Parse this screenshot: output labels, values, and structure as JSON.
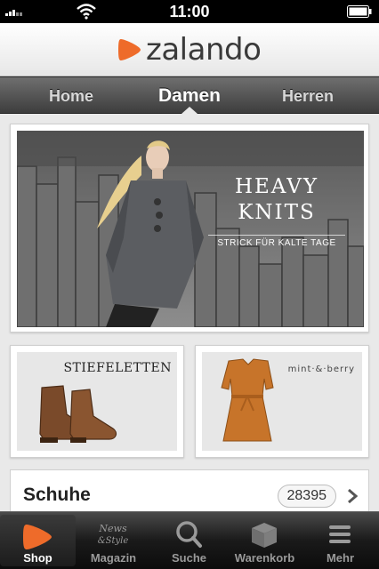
{
  "status_bar": {
    "time": "11:00"
  },
  "header": {
    "brand": "zalando",
    "brand_color": "#ee6b2a"
  },
  "top_tabs": {
    "home": "Home",
    "damen": "Damen",
    "herren": "Herren",
    "active": "Damen"
  },
  "hero": {
    "title_line1": "HEAVY",
    "title_line2": "KNITS",
    "subtitle": "STRICK FÜR KALTE TAGE"
  },
  "tiles": {
    "boots": {
      "label": "STIEFELETTEN"
    },
    "dress": {
      "label": "mint·&·berry"
    }
  },
  "category": {
    "label": "Schuhe",
    "count": "28395"
  },
  "tab_bar": {
    "items": [
      {
        "label": "Shop",
        "icon": "zalando-icon",
        "active": true
      },
      {
        "label": "Magazin",
        "icon": "news-style-icon"
      },
      {
        "label": "Suche",
        "icon": "search-icon"
      },
      {
        "label": "Warenkorb",
        "icon": "cart-box-icon"
      },
      {
        "label": "Mehr",
        "icon": "menu-icon"
      }
    ],
    "magazin_logo": "News & Style"
  }
}
